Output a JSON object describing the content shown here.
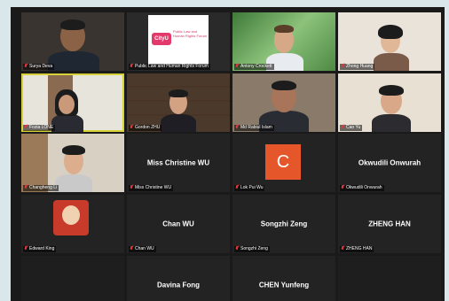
{
  "participants": [
    {
      "name": "Surya Deva",
      "center_name": ""
    },
    {
      "name": "Public Law and Human Rights Forum",
      "center_name": ""
    },
    {
      "name": "Antony Crockett",
      "center_name": ""
    },
    {
      "name": "Zhong Huang",
      "center_name": ""
    },
    {
      "name": "Fozia LONE",
      "center_name": ""
    },
    {
      "name": "Gordon ZHU",
      "center_name": ""
    },
    {
      "name": "Md Rabiul Islam",
      "center_name": ""
    },
    {
      "name": "Cao Yu",
      "center_name": ""
    },
    {
      "name": "Changheng Li",
      "center_name": ""
    },
    {
      "name": "Miss Christine WU",
      "center_name": "Miss Christine WU"
    },
    {
      "name": "Lok Pui Wu",
      "center_name": ""
    },
    {
      "name": "Okwudili Onwurah",
      "center_name": "Okwudili Onwurah"
    },
    {
      "name": "Edward King",
      "center_name": ""
    },
    {
      "name": "Chan WU",
      "center_name": "Chan WU"
    },
    {
      "name": "Songzhi Zeng",
      "center_name": "Songzhi Zeng"
    },
    {
      "name": "ZHENG HAN",
      "center_name": "ZHENG HAN"
    },
    {
      "name": "",
      "center_name": ""
    },
    {
      "name": "",
      "center_name": "Davina Fong"
    },
    {
      "name": "",
      "center_name": "CHEN Yunfeng"
    },
    {
      "name": "",
      "center_name": ""
    }
  ],
  "avatar_initial": "C",
  "poster_logo": "CityU",
  "poster_text": "Public Law and Human Rights Forum",
  "colors": {
    "background": "#1a1a1a",
    "tile": "#232323",
    "active_border": "#d8d23a",
    "avatar": "#e5572b",
    "muted_icon": "#e0393b"
  }
}
